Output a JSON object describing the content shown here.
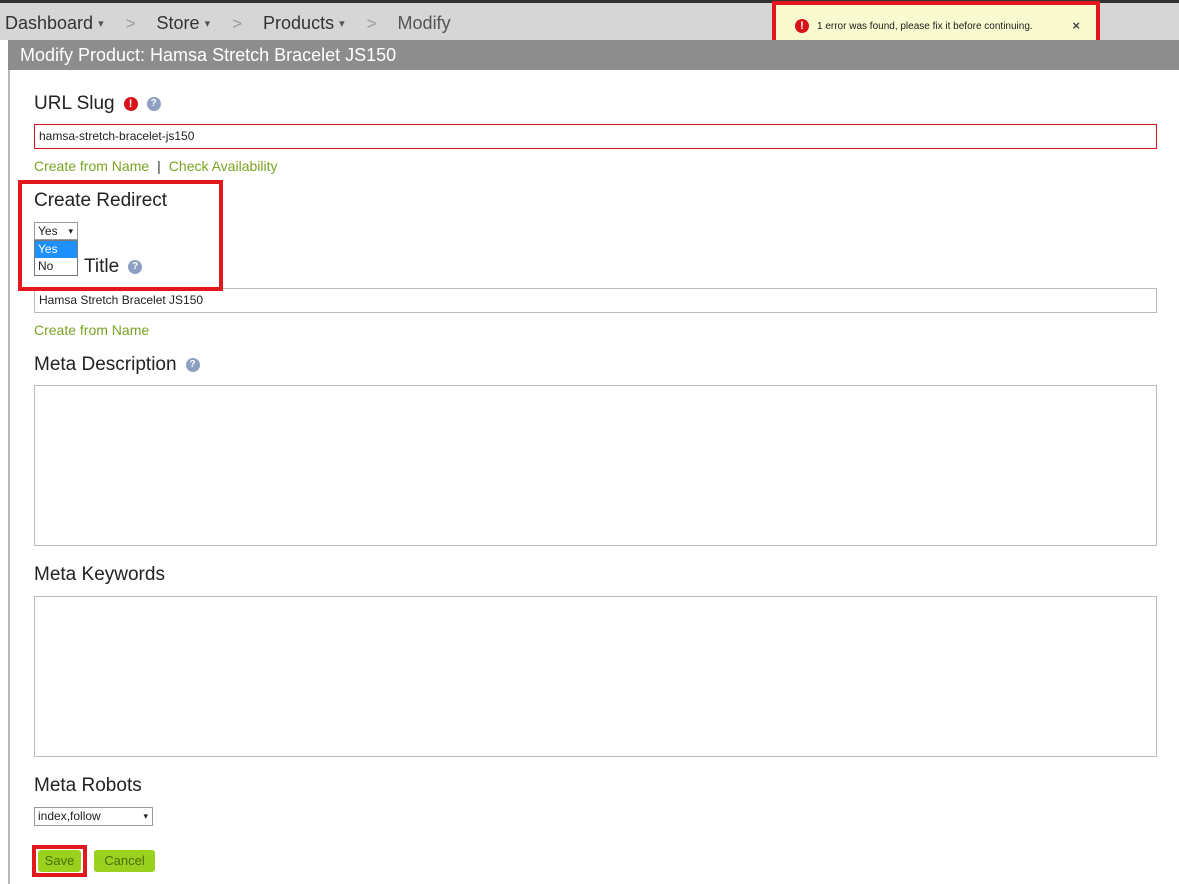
{
  "breadcrumb": {
    "items": [
      {
        "label": "Dashboard"
      },
      {
        "label": "Store"
      },
      {
        "label": "Products"
      },
      {
        "label": "Modify"
      }
    ],
    "separator": ">",
    "caret": "▾"
  },
  "alert": {
    "icon": "!",
    "message": "1 error was found, please fix it before continuing.",
    "close": "×"
  },
  "page": {
    "title": "Modify Product: Hamsa Stretch Bracelet JS150"
  },
  "form": {
    "url_slug": {
      "label": "URL Slug",
      "value": "hamsa-stretch-bracelet-js150",
      "link_create": "Create from Name",
      "link_separator": "|",
      "link_check": "Check Availability"
    },
    "create_redirect": {
      "label": "Create Redirect",
      "selected": "Yes",
      "options": [
        "Yes",
        "No"
      ]
    },
    "page_title": {
      "label": "Title",
      "value": "Hamsa Stretch Bracelet JS150",
      "link_create": "Create from Name"
    },
    "meta_description": {
      "label": "Meta Description",
      "value": ""
    },
    "meta_keywords": {
      "label": "Meta Keywords",
      "value": ""
    },
    "meta_robots": {
      "label": "Meta Robots",
      "selected": "index,follow"
    }
  },
  "buttons": {
    "save": "Save",
    "cancel": "Cancel"
  },
  "icons": {
    "help": "?",
    "error": "!",
    "dropdown": "▾"
  },
  "colors": {
    "accent_green": "#9ad01e",
    "link_green": "#7aa323",
    "error_red": "#d8121a",
    "highlight_red": "#e1191f",
    "alert_bg": "#fafad0",
    "title_bar": "#8d8d8d"
  }
}
